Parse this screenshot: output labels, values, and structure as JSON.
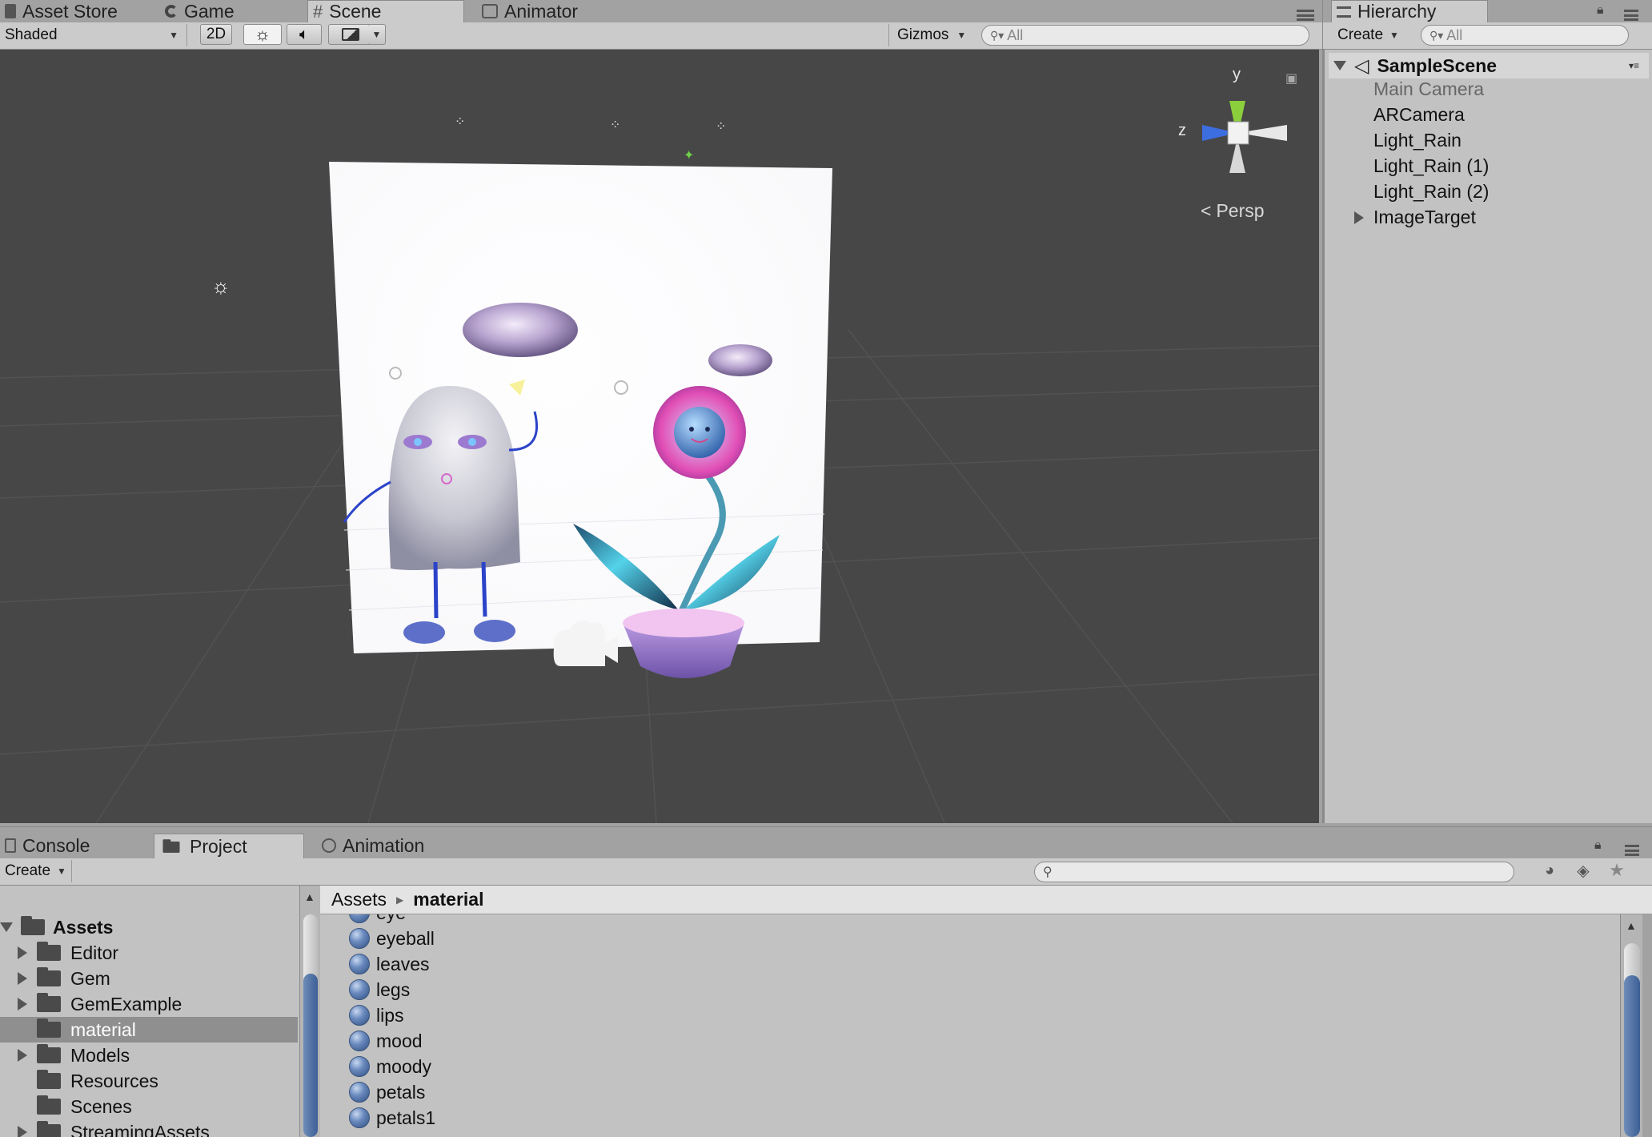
{
  "top_tabs": [
    {
      "label": "Asset Store",
      "icon": "asset-store-icon"
    },
    {
      "label": "Game",
      "icon": "game-icon"
    },
    {
      "label": "Scene",
      "icon": "scene-grid-icon"
    },
    {
      "label": "Animator",
      "icon": "animator-icon"
    }
  ],
  "scene_toolbar": {
    "shading_mode": "Shaded",
    "mode_2d": "2D",
    "gizmos": "Gizmos",
    "search_placeholder": "All"
  },
  "scene_view": {
    "projection": "Persp",
    "axis_y": "y",
    "axis_z": "z"
  },
  "hierarchy": {
    "tab_label": "Hierarchy",
    "create_label": "Create",
    "search_placeholder": "All",
    "scene_name": "SampleScene",
    "items": [
      "Main Camera",
      "ARCamera",
      "Light_Rain",
      "Light_Rain (1)",
      "Light_Rain (2)",
      "ImageTarget"
    ]
  },
  "bottom_tabs": [
    {
      "label": "Console",
      "icon": "console-icon"
    },
    {
      "label": "Project",
      "icon": "folder-icon"
    },
    {
      "label": "Animation",
      "icon": "clock-icon"
    }
  ],
  "project": {
    "create_label": "Create",
    "breadcrumb_root": "Assets",
    "breadcrumb_current": "material",
    "tree": [
      "Assets",
      "Editor",
      "Gem",
      "GemExample",
      "material",
      "Models",
      "Resources",
      "Scenes",
      "StreamingAssets"
    ],
    "materials": [
      "eye",
      "eyeball",
      "leaves",
      "legs",
      "lips",
      "mood",
      "moody",
      "petals",
      "petals1"
    ]
  },
  "colors": {
    "scene_bg": "#474747",
    "panel_bg": "#c2c2c2",
    "selection": "#8f8f8f",
    "axis_y": "#8ccf3c",
    "axis_z": "#3d6ee0"
  }
}
